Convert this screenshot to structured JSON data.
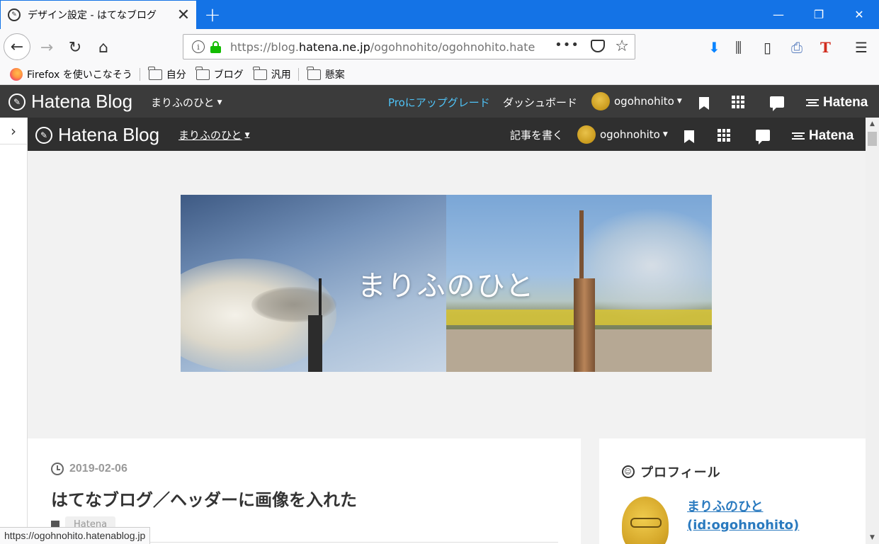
{
  "browser": {
    "tab_title": "デザイン設定 - はてなブログ",
    "tab_close": "✕",
    "new_tab": "+",
    "window_controls": {
      "minimize": "—",
      "restore": "❐",
      "close": "✕"
    },
    "url_prefix": "https://blog.",
    "url_host": "hatena.ne.jp",
    "url_path": "/ogohnohito/ogohnohito.haten",
    "url_more": "•••",
    "bookmarks": [
      {
        "label": "Firefox を使いこなそう",
        "icon": "firefox-icon"
      },
      {
        "label": "自分",
        "icon": "folder-icon"
      },
      {
        "label": "ブログ",
        "icon": "folder-icon"
      },
      {
        "label": "汎用",
        "icon": "folder-icon"
      },
      {
        "label": "懸案",
        "icon": "folder-icon"
      }
    ],
    "status_url": "https://ogohnohito.hatenablog.jp"
  },
  "hatena_bar_outer": {
    "logo": "Hatena Blog",
    "blog_menu": "まりふのひと",
    "pro_upgrade": "Proにアップグレード",
    "dashboard": "ダッシュボード",
    "user": "ogohnohito",
    "hatena": "Hatena"
  },
  "hatena_bar_inner": {
    "logo": "Hatena Blog",
    "blog_menu": "まりふのひと",
    "write_post": "記事を書く",
    "user": "ogohnohito",
    "hatena": "Hatena"
  },
  "blog": {
    "header_title": "まりふのひと"
  },
  "article": {
    "date": "2019-02-06",
    "title": "はてなブログ／ヘッダーに画像を入れた",
    "category": "Hatena"
  },
  "profile": {
    "heading": "プロフィール",
    "name": "まりふのひと",
    "id": "(id:ogohnohito)"
  },
  "colors": {
    "tabbar": "#1473e6",
    "hatena_bar": "#3b3b3b",
    "pro_link": "#4fc3f7",
    "profile_link": "#2a7abf",
    "secure_lock": "#12bc00"
  }
}
